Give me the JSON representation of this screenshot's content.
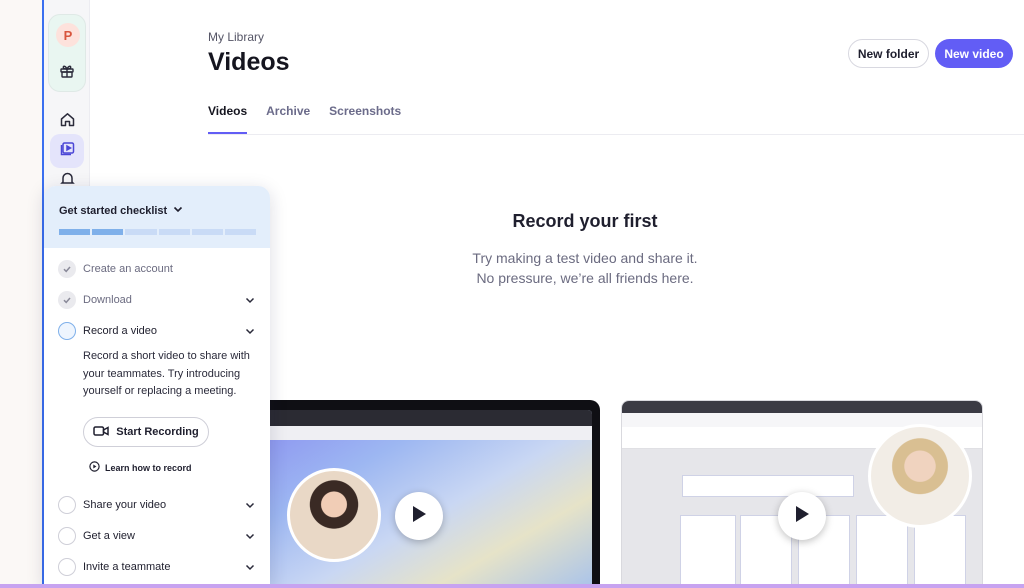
{
  "sidebar": {
    "avatar_initial": "P",
    "icons": [
      "gift-icon",
      "home-icon",
      "library-icon",
      "bell-icon"
    ]
  },
  "header": {
    "breadcrumb": "My Library",
    "title": "Videos",
    "new_folder_label": "New folder",
    "new_video_label": "New video"
  },
  "tabs": [
    {
      "label": "Videos",
      "active": true
    },
    {
      "label": "Archive",
      "active": false
    },
    {
      "label": "Screenshots",
      "active": false
    }
  ],
  "empty_state": {
    "title": "Record your first",
    "line1": "Try making a test video and share it.",
    "line2": "No pressure, we’re all friends here."
  },
  "checklist": {
    "title": "Get started checklist",
    "progress": {
      "completed": 2,
      "total": 6
    },
    "items": [
      {
        "label": "Create an account",
        "status": "done",
        "expandable": false
      },
      {
        "label": "Download",
        "status": "done",
        "expandable": true
      },
      {
        "label": "Record a video",
        "status": "current",
        "expandable": true
      },
      {
        "label": "Share your video",
        "status": "todo",
        "expandable": true
      },
      {
        "label": "Get a view",
        "status": "todo",
        "expandable": true
      },
      {
        "label": "Invite a teammate",
        "status": "todo",
        "expandable": true
      }
    ],
    "record_description": "Record a short video to share with your teammates. Try introducing yourself or replacing a meeting.",
    "start_recording_label": "Start Recording",
    "learn_label": "Learn how to record"
  },
  "colors": {
    "accent": "#625df5",
    "progress_done": "#7fb0ea",
    "progress_todo": "#c9dbf6",
    "checklist_header": "#e3eefb"
  }
}
